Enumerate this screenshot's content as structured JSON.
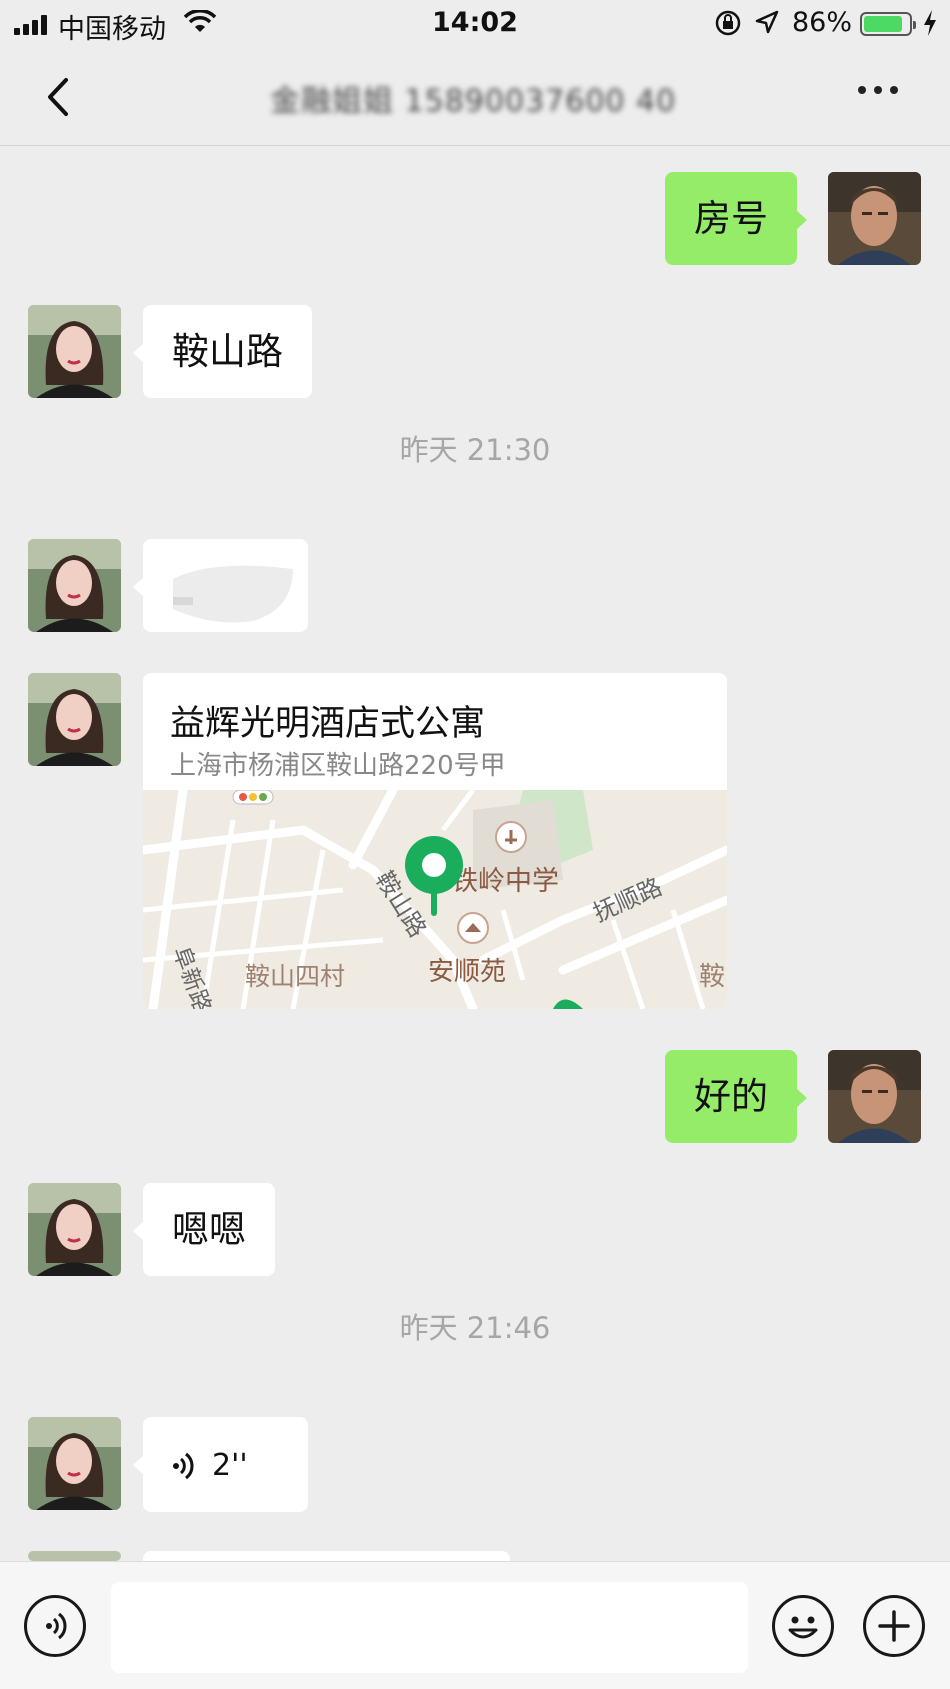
{
  "status_bar": {
    "carrier": "中国移动",
    "time": "14:02",
    "battery_percent": "86%",
    "battery_level": 0.86
  },
  "header": {
    "title": "金融姐姐 15890037600 40"
  },
  "messages": [
    {
      "side": "me",
      "type": "text",
      "text": "房号"
    },
    {
      "side": "them",
      "type": "text",
      "text": "鞍山路"
    },
    {
      "type": "timestamp",
      "text": "昨天 21:30"
    },
    {
      "side": "them",
      "type": "image"
    },
    {
      "side": "them",
      "type": "location",
      "name": "益辉光明酒店式公寓",
      "address": "上海市杨浦区鞍山路220号甲",
      "map_labels": [
        "铁岭中学",
        "抚顺路",
        "鞍山路",
        "安顺苑",
        "鞍山四村",
        "阜新路",
        "鞍"
      ]
    },
    {
      "side": "me",
      "type": "text",
      "text": "好的"
    },
    {
      "side": "them",
      "type": "text",
      "text": "嗯嗯"
    },
    {
      "type": "timestamp",
      "text": "昨天 21:46"
    },
    {
      "side": "them",
      "type": "voice",
      "duration": "2''"
    }
  ],
  "icons": [
    "back-icon",
    "more-icon",
    "voice-input-icon",
    "emoji-icon",
    "plus-icon",
    "wifi-icon",
    "location-arrow-icon",
    "rotation-lock-icon",
    "charging-bolt-icon"
  ]
}
